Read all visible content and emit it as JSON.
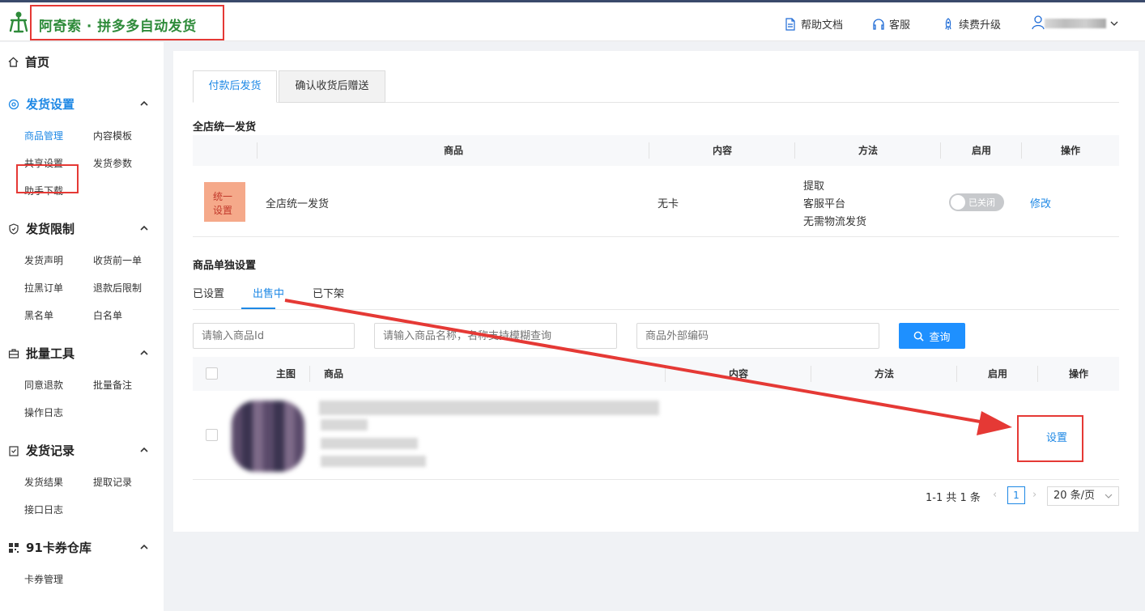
{
  "header": {
    "brand": "阿奇索 · 拼多多自动发货",
    "links": {
      "help": "帮助文档",
      "service": "客服",
      "renew": "续费升级"
    }
  },
  "sidebar": {
    "home": "首页",
    "groups": [
      {
        "title": "发货设置",
        "items": [
          "商品管理",
          "内容模板",
          "共享设置",
          "发货参数",
          "助手下载"
        ]
      },
      {
        "title": "发货限制",
        "items": [
          "发货声明",
          "收货前一单",
          "拉黑订单",
          "退款后限制",
          "黑名单",
          "白名单"
        ]
      },
      {
        "title": "批量工具",
        "items": [
          "同意退款",
          "批量备注",
          "操作日志"
        ]
      },
      {
        "title": "发货记录",
        "items": [
          "发货结果",
          "提取记录",
          "接口日志"
        ]
      },
      {
        "title": "91卡券仓库",
        "items": [
          "卡券管理"
        ]
      }
    ]
  },
  "main": {
    "tabs": [
      "付款后发货",
      "确认收货后赠送"
    ],
    "unified": {
      "title": "全店统一发货",
      "columns": [
        "商品",
        "内容",
        "方法",
        "启用",
        "操作"
      ],
      "image_text": [
        "统一",
        "设置"
      ],
      "row": {
        "name": "全店统一发货",
        "content": "无卡",
        "methods": [
          "提取",
          "客服平台",
          "无需物流发货"
        ],
        "toggle": "已关闭",
        "action": "修改"
      }
    },
    "single": {
      "title": "商品单独设置",
      "subtabs": [
        "已设置",
        "出售中",
        "已下架"
      ],
      "search": {
        "id_placeholder": "请输入商品Id",
        "name_placeholder": "请输入商品名称，名称支持模糊查询",
        "code_placeholder": "商品外部编码",
        "button": "查询"
      },
      "columns": [
        "主图",
        "商品",
        "内容",
        "方法",
        "启用",
        "操作"
      ],
      "row": {
        "action": "设置"
      },
      "pagination": {
        "total": "1-1 共 1 条",
        "page": "1",
        "size": "20 条/页"
      }
    }
  },
  "colors": {
    "accent": "#1e88e5",
    "brand": "#2e8b3a",
    "highlight": "#e53935"
  }
}
